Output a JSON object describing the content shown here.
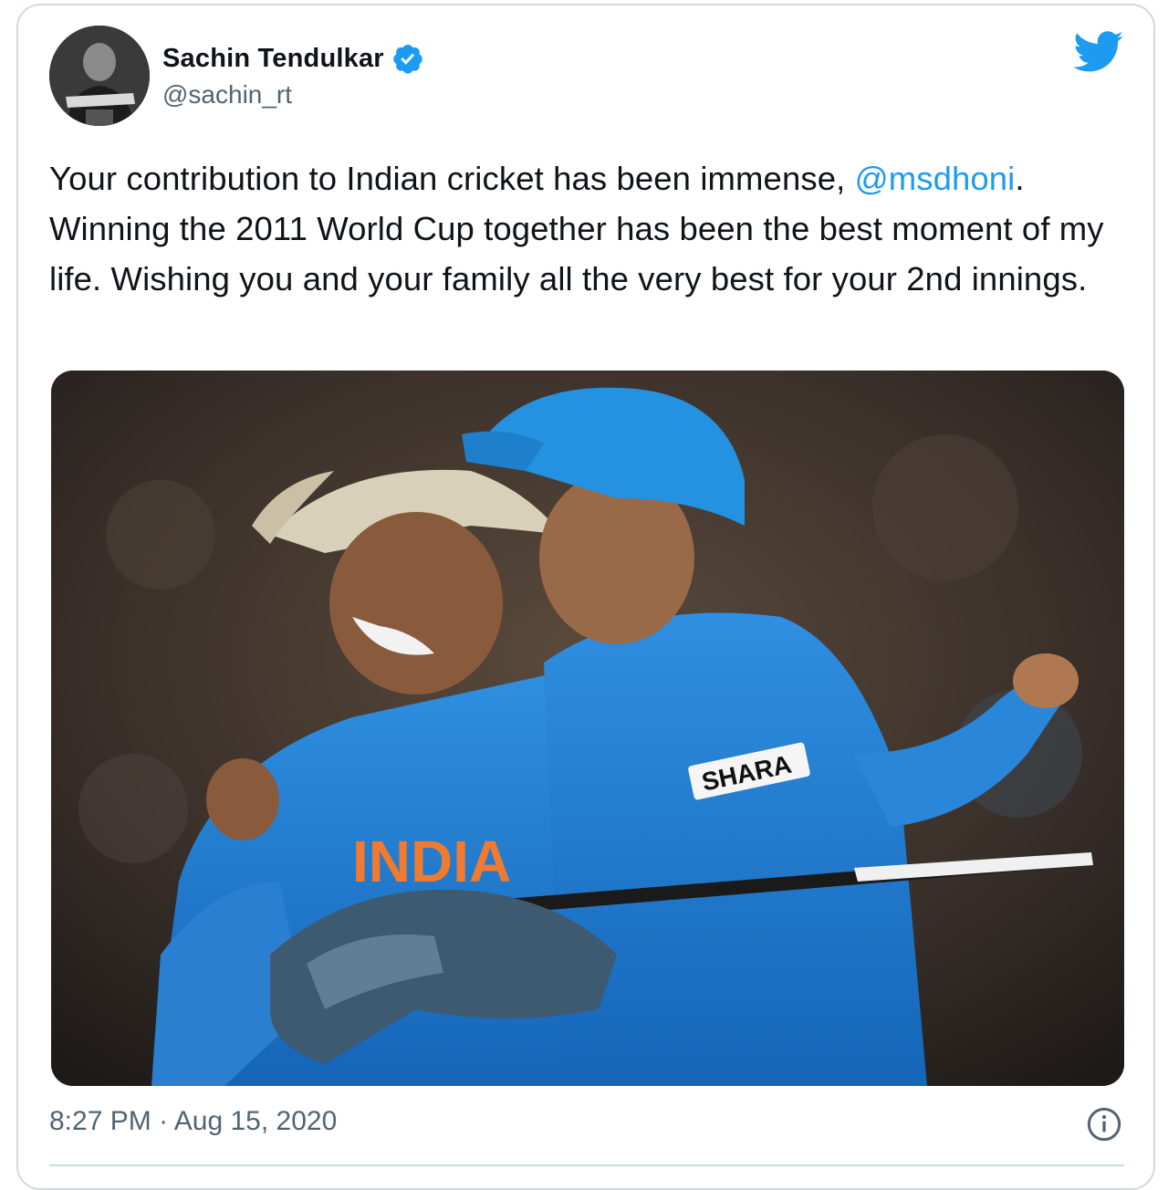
{
  "author": {
    "display_name": "Sachin Tendulkar",
    "handle": "@sachin_rt",
    "verified": true,
    "avatar_icon": "profile-photo"
  },
  "tweet": {
    "text_part1": "Your contribution to Indian cricket has been immense, ",
    "mention": "@msdhoni",
    "text_part2": ". Winning the 2011 World Cup together has been the best moment of my life. Wishing you and your family all the very best for your 2nd innings.",
    "time": "8:27 PM",
    "separator": "·",
    "date": "Aug 15, 2020"
  },
  "media": {
    "jersey_text": "INDIA",
    "sponsor_text": "SHARA"
  },
  "icons": {
    "brand": "twitter-bird-icon",
    "verified": "verified-badge-icon",
    "info": "info-icon"
  },
  "colors": {
    "accent": "#1d9bf0",
    "text": "#0f1419",
    "muted": "#536471",
    "border": "#cfd9de"
  }
}
